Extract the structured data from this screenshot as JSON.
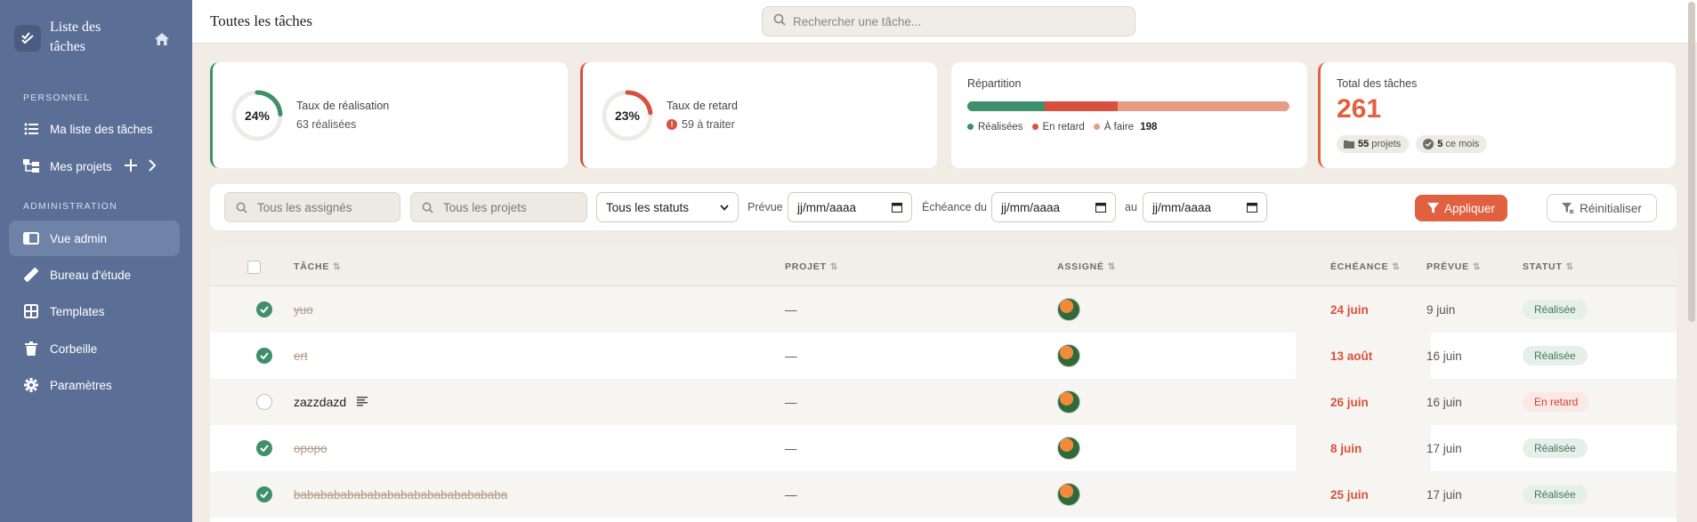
{
  "app": {
    "title": "Liste des tâches",
    "colors": {
      "sidebar": "#5b6f96",
      "accent": "#e0603f",
      "success": "#3f8f6a",
      "danger": "#d9513e"
    }
  },
  "sidebar": {
    "sections": [
      {
        "label": "PERSONNEL"
      },
      {
        "label": "ADMINISTRATION"
      }
    ],
    "items": [
      {
        "label": "Ma liste des tâches",
        "icon": "list-icon",
        "active": false
      },
      {
        "label": "Mes projets",
        "icon": "projects-icon",
        "active": false
      },
      {
        "label": "Vue admin",
        "icon": "admin-view-icon",
        "active": true
      },
      {
        "label": "Bureau d'étude",
        "icon": "ruler-icon",
        "active": false
      },
      {
        "label": "Templates",
        "icon": "grid-icon",
        "active": false
      },
      {
        "label": "Corbeille",
        "icon": "trash-icon",
        "active": false
      },
      {
        "label": "Paramètres",
        "icon": "gear-icon",
        "active": false
      }
    ]
  },
  "header": {
    "title": "Toutes les tâches",
    "search_placeholder": "Rechercher une tâche..."
  },
  "stats": {
    "completion": {
      "percent_label": "24%",
      "percent": 24,
      "title": "Taux de réalisation",
      "sub": "63 réalisées"
    },
    "late": {
      "percent_label": "23%",
      "percent": 23,
      "title": "Taux de retard",
      "sub": "59 à traiter"
    },
    "distribution": {
      "title": "Répartition",
      "segments": [
        {
          "label": "Réalisées",
          "value": 63,
          "color": "#3f8f6a"
        },
        {
          "label": "En retard",
          "value": 59,
          "color": "#d9513e"
        },
        {
          "label": "À faire",
          "value": 139,
          "color": "#e89c84"
        }
      ],
      "todo_count": "198"
    },
    "total": {
      "title": "Total des tâches",
      "value": "261",
      "projects_count": "55",
      "projects_label": "projets",
      "month_count": "5",
      "month_label": "ce mois"
    }
  },
  "filters": {
    "assignees_placeholder": "Tous les assignés",
    "projects_placeholder": "Tous les projets",
    "status_selected": "Tous les statuts",
    "planned_label": "Prévue",
    "date_placeholder": "jj/mm/aaaa",
    "due_from_label": "Échéance du",
    "due_to_label": "au",
    "apply_label": "Appliquer",
    "reset_label": "Réinitialiser"
  },
  "table": {
    "columns": [
      "TÂCHE",
      "PROJET",
      "ASSIGNÉ",
      "ÉCHÉANCE",
      "PRÉVUE",
      "STATUT"
    ],
    "rows": [
      {
        "task": "yuo",
        "project": "—",
        "due": "24 juin",
        "planned": "9 juin",
        "status": "Réalisée",
        "done": true
      },
      {
        "task": "ert",
        "project": "—",
        "due": "13 août",
        "planned": "16 juin",
        "status": "Réalisée",
        "done": true
      },
      {
        "task": "zazzdazd",
        "project": "—",
        "due": "26 juin",
        "planned": "16 juin",
        "status": "En retard",
        "done": false
      },
      {
        "task": "opopo",
        "project": "—",
        "due": "8 juin",
        "planned": "17 juin",
        "status": "Réalisée",
        "done": true
      },
      {
        "task": "babababababababababababababababa",
        "project": "—",
        "due": "25 juin",
        "planned": "17 juin",
        "status": "Réalisée",
        "done": true
      }
    ]
  }
}
